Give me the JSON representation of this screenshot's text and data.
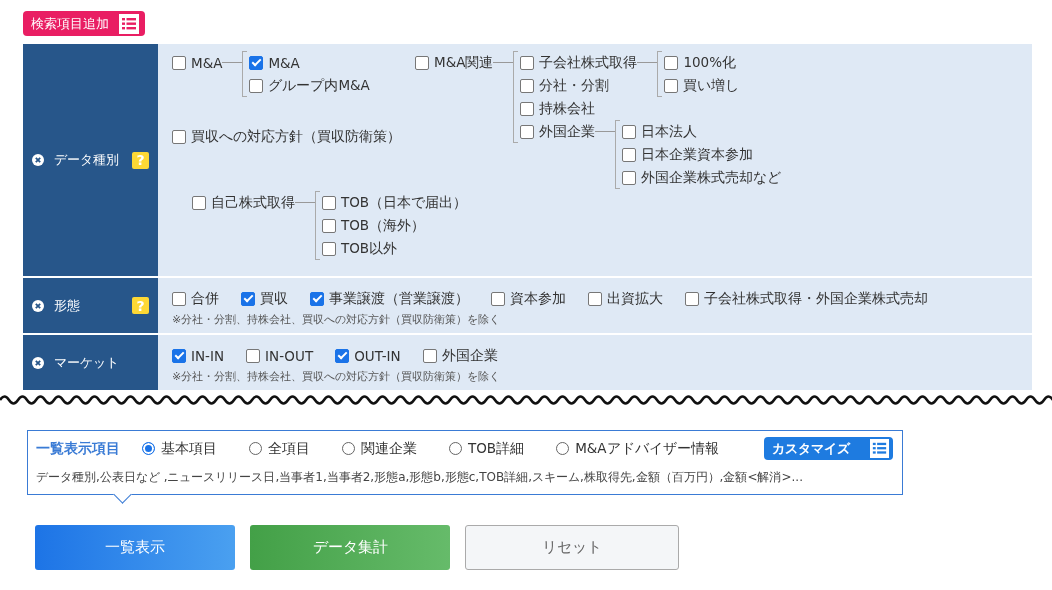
{
  "add_button": {
    "label": "検索項目追加"
  },
  "criteria": [
    {
      "kind": "tree",
      "label": "データ種別",
      "help": "?",
      "columns": [
        [
          {
            "label": "M&A",
            "checked": false,
            "children": [
              {
                "label": "M&A",
                "checked": true
              },
              {
                "label": "グループ内M&A",
                "checked": false
              }
            ]
          },
          {
            "label": "買収への対応方針（買収防衛策）",
            "checked": false
          }
        ],
        [
          {
            "label": "M&A関連",
            "checked": false,
            "children": [
              {
                "label": "子会社株式取得",
                "checked": false,
                "children": [
                  {
                    "label": "100%化",
                    "checked": false
                  },
                  {
                    "label": "買い増し",
                    "checked": false
                  }
                ]
              },
              {
                "label": "分社・分割",
                "checked": false
              },
              {
                "label": "持株会社",
                "checked": false
              },
              {
                "label": "外国企業",
                "checked": false,
                "children": [
                  {
                    "label": "日本法人",
                    "checked": false
                  },
                  {
                    "label": "日本企業資本参加",
                    "checked": false
                  },
                  {
                    "label": "外国企業株式売却など",
                    "checked": false
                  }
                ]
              }
            ]
          }
        ]
      ],
      "lower": [
        {
          "label": "自己株式取得",
          "checked": false,
          "children": [
            {
              "label": "TOB（日本で届出）",
              "checked": false
            },
            {
              "label": "TOB（海外）",
              "checked": false
            },
            {
              "label": "TOB以外",
              "checked": false
            }
          ]
        }
      ]
    },
    {
      "kind": "checks",
      "label": "形態",
      "help": "?",
      "options": [
        {
          "label": "合併",
          "checked": false
        },
        {
          "label": "買収",
          "checked": true
        },
        {
          "label": "事業譲渡（営業譲渡）",
          "checked": true
        },
        {
          "label": "資本参加",
          "checked": false
        },
        {
          "label": "出資拡大",
          "checked": false
        },
        {
          "label": "子会社株式取得・外国企業株式売却",
          "checked": false
        }
      ],
      "note": "※分社・分割、持株会社、買収への対応方針（買収防衛策）を除く"
    },
    {
      "kind": "checks",
      "label": "マーケット",
      "options": [
        {
          "label": "IN-IN",
          "checked": true
        },
        {
          "label": "IN-OUT",
          "checked": false
        },
        {
          "label": "OUT-IN",
          "checked": true
        },
        {
          "label": "外国企業",
          "checked": false
        }
      ],
      "note": "※分社・分割、持株会社、買収への対応方針（買収防衛策）を除く"
    }
  ],
  "display": {
    "label": "一覧表示項目",
    "options": [
      {
        "label": "基本項目",
        "selected": true
      },
      {
        "label": "全項目",
        "selected": false
      },
      {
        "label": "関連企業",
        "selected": false
      },
      {
        "label": "TOB詳細",
        "selected": false
      },
      {
        "label": "M&Aアドバイザー情報",
        "selected": false
      }
    ],
    "customize": "カスタマイズ",
    "columns_text": "データ種別,公表日など ,ニュースリリース日,当事者1,当事者2,形態a,形態b,形態c,TOB詳細,スキーム,株取得先,金額（百万円）,金額<解消>..."
  },
  "buttons": [
    {
      "label": "一覧表示",
      "kind": "primary"
    },
    {
      "label": "データ集計",
      "kind": "success"
    },
    {
      "label": "リセット",
      "kind": "default"
    }
  ]
}
